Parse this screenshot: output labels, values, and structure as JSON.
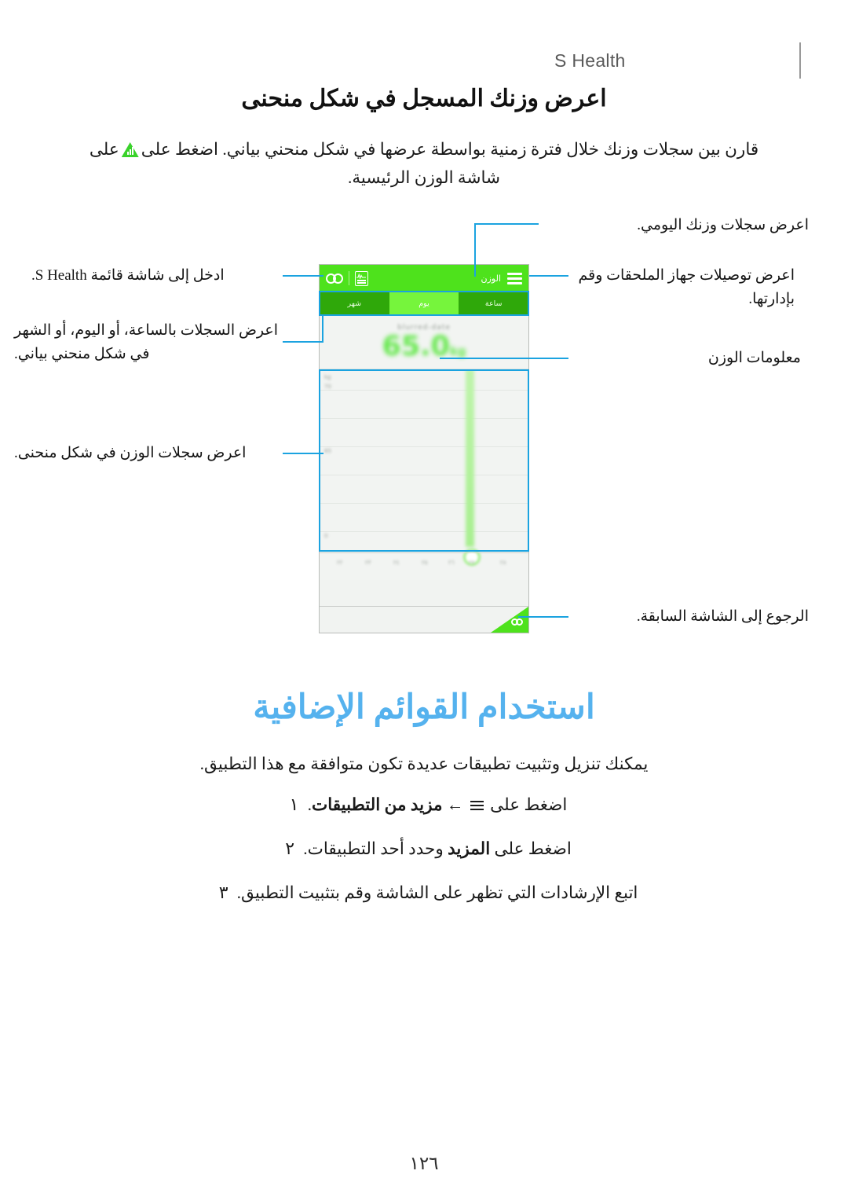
{
  "header": {
    "title": "S Health"
  },
  "section1": {
    "title": "اعرض وزنك المسجل في شكل منحنى",
    "intro_before": "قارن بين سجلات وزنك خلال فترة زمنية بواسطة عرضها في شكل منحني بياني. اضغط على",
    "intro_icon": "bar-chart-triangle-icon",
    "intro_after": "على شاشة الوزن الرئيسية."
  },
  "phone": {
    "appbar": {
      "menu_icon": "hamburger-icon",
      "title": "الوزن",
      "trend_icon": "trend-chart-icon",
      "link_icon": "accessory-link-icon"
    },
    "tabs": [
      {
        "label": "ساعة",
        "selected": false
      },
      {
        "label": "يوم",
        "selected": true
      },
      {
        "label": "شهر",
        "selected": false
      }
    ],
    "reading": {
      "date": "blurred-date",
      "value": "65.0",
      "unit": "kg"
    },
    "chart": {
      "y_labels": [
        "kg",
        "70",
        "65",
        "0"
      ],
      "x_labels": [
        "٢٢",
        "٢٣",
        "٢٤",
        "٢٥",
        "٢٦",
        "٢٧",
        "٢٨"
      ]
    },
    "navbar": {
      "back_icon": "back-arrow-icon"
    }
  },
  "callouts": {
    "daily_records": "اعرض سجلات وزنك اليومي.",
    "accessories": "اعرض توصيلات جهاز الملحقات وقم بإدارتها.",
    "weight_info": "معلومات الوزن",
    "back_to_previous": "الرجوع إلى الشاشة السابقة.",
    "menu_screen": "ادخل إلى شاشة قائمة S Health.",
    "records_by_period": "اعرض السجلات بالساعة، أو اليوم، أو الشهر في شكل منحني بياني.",
    "weight_curve": "اعرض سجلات الوزن في شكل منحنى."
  },
  "section2": {
    "heading": "استخدام القوائم الإضافية",
    "intro": "يمكنك تنزيل وتثبيت تطبيقات عديدة تكون متوافقة مع هذا التطبيق.",
    "steps": [
      {
        "num": "١",
        "text_before": "اضغط على",
        "icon": "hamburger-icon",
        "text_arrow": "←",
        "text_bold": "مزيد من التطبيقات",
        "text_after": "."
      },
      {
        "num": "٢",
        "text_before": "اضغط على",
        "text_bold": "المزيد",
        "text_after": "وحدد أحد التطبيقات."
      },
      {
        "num": "٣",
        "text_before": "اتبع الإرشادات التي تظهر على الشاشة وقم بتثبيت التطبيق.",
        "text_bold": "",
        "text_after": ""
      }
    ]
  },
  "footer": {
    "page_number": "١٢٦"
  },
  "colors": {
    "brand_green": "#4ee21c",
    "tab_green": "#2fa80a",
    "tab_selected": "#76f53c",
    "highlight_blue": "#1ba3e0",
    "heading_blue": "#55b2ee"
  }
}
